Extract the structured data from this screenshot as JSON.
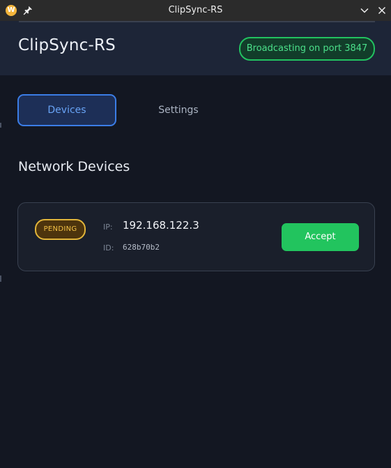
{
  "window": {
    "title": "ClipSync-RS",
    "app_icon_letter": "W",
    "icons": [
      "app-icon",
      "pin-icon",
      "chevron-down-icon",
      "close-icon"
    ]
  },
  "header": {
    "app_name": "ClipSync-RS",
    "status": "Broadcasting on port 3847"
  },
  "tabs": [
    {
      "label": "Devices",
      "active": true
    },
    {
      "label": "Settings",
      "active": false
    }
  ],
  "section": {
    "title": "Network Devices"
  },
  "devices": [
    {
      "status": "PENDING",
      "ip_label": "IP:",
      "ip": "192.168.122.3",
      "id_label": "ID:",
      "id": "628b70b2",
      "action": "Accept"
    }
  ],
  "colors": {
    "background": "#131722",
    "header": "#1d2537",
    "accent_blue": "#3b7de6",
    "success_green": "#22c45e",
    "pending_amber": "#e2b53a"
  }
}
